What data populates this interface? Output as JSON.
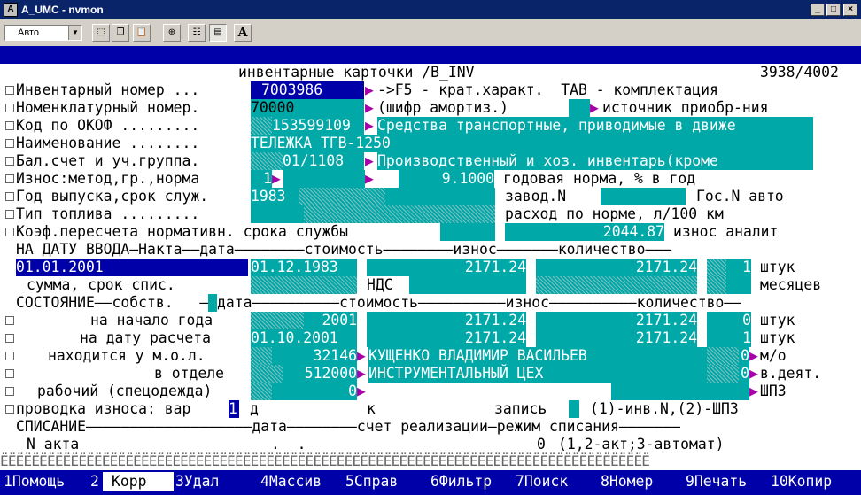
{
  "window": {
    "title": "A_UMC - nvmon",
    "controls": [
      "_",
      "□",
      "×"
    ]
  },
  "toolbar": {
    "font_select": "Авто",
    "a_button": "A"
  },
  "header": {
    "title": "инвентарные карточки /B_INV",
    "record": "3938/4002"
  },
  "form": {
    "inv_label": "Инвентарный номер ...",
    "inv_value": "7003986",
    "inv_hint": "->F5 - крат.характ.  TAB - комплектация",
    "nom_label": "Номенклатурный номер.",
    "nom_value": "70000",
    "shifr_label": "(шифр амортиз.)",
    "source_label": "источник приобр-ния",
    "okof_label": "Код по ОКОФ .........",
    "okof_code": "153599109",
    "okof_desc": "Средства транспортные, приводимые в движе",
    "name_label": "Наименование ........",
    "name_value": "ТЕЛЕЖКА ТГВ-1250",
    "bal_label": "Бал.счет и уч.группа.",
    "bal_value": "01/1108",
    "bal_desc": "Производственный и хоз. инвентарь(кроме",
    "iznos_label": "Износ:метод,гр.,норма",
    "iznos_method": "1",
    "iznos_rate": "9.1000",
    "iznos_rate_label": "годовая норма, % в год",
    "year_label": "Год выпуска,срок служ.",
    "year_value": "1983",
    "zavod_label": "завод.N",
    "gos_label": "Гос.N авто",
    "fuel_label": "Тип топлива .........",
    "fuel_consumption_label": "расход по норме, л/100 км",
    "koef_label": "Коэф.пересчета нормативн. срока службы",
    "iznos_analit_value": "2044.87",
    "iznos_analit_label": "износ аналит"
  },
  "vvod": {
    "header_line": "НА ДАТУ ВВОДА—Накта——дата————————стоимость————————износ———————количество———",
    "date": "01.01.2001",
    "akt_date": "01.12.1983",
    "cost": "2171.24",
    "wear": "2171.24",
    "qty": "1",
    "unit": "штук",
    "sum_label": "сумма, срок спис.",
    "nds_label": "НДС",
    "months_label": "месяцев"
  },
  "state": {
    "header_line": "СОСТОЯНИЕ——собств.   ——дата——————————стоимость——————————износ——————————количество——",
    "start_label": "на начало года",
    "start_date": "2001",
    "start_cost": "2171.24",
    "start_wear": "2171.24",
    "start_qty": "0",
    "start_unit": "штук",
    "calc_label": "на дату расчета",
    "calc_date": "01.10.2001",
    "calc_cost": "2171.24",
    "calc_wear": "2171.24",
    "calc_qty": "1",
    "calc_unit": "штук",
    "mol_label": "находится у м.о.л.",
    "mol_code": "32146",
    "mol_name": "КУЩЕНКО ВЛАДИМИР ВАСИЛЬЕВ",
    "mol_qty": "0",
    "mol_unit": "м/о",
    "dept_label": "в отделе",
    "dept_code": "512000",
    "dept_name": "ИНСТРУМЕНТАЛЬНЫЙ ЦЕХ",
    "dept_qty": "0",
    "dept_unit": "в.деят.",
    "work_label": "рабочий (спецодежда)",
    "work_code": "0",
    "work_unit": "ШПЗ"
  },
  "posting": {
    "label": "проводка износа: вар",
    "var": "1",
    "d_label": "д",
    "k_label": "к",
    "record_label": "запись",
    "record_hint": "(1)-инв.N,(2)-ШПЗ"
  },
  "writeoff": {
    "header_line": "СПИСАНИЕ———————————————————дата————————счет реализации—режим списания———————",
    "akt_label": "N акта",
    "akt_dots": ".  .",
    "mode_value": "0",
    "mode_hint": "(1,2-акт;3-автомат)"
  },
  "separator_text": "ЁЁЁЁЁЁЁЁЁЁЁЁЁЁЁЁЁЁЁЁЁЁЁЁЁЁЁЁЁЁЁЁЁЁЁЁЁЁЁЁЁЁЁЁЁЁЁЁЁЁЁЁЁЁЁЁЁЁЁЁЁЁЁЁЁЁЁЁЁЁЁЁЁЁЁЁЁЁЁЁЁЁЁ",
  "fkeys": [
    {
      "num": "1",
      "label": "Помощь"
    },
    {
      "num": "2",
      "label": "Корр"
    },
    {
      "num": "3",
      "label": "Удал"
    },
    {
      "num": "4",
      "label": "Массив"
    },
    {
      "num": "5",
      "label": "Справ"
    },
    {
      "num": "6",
      "label": "Фильтр"
    },
    {
      "num": "7",
      "label": "Поиск"
    },
    {
      "num": "8",
      "label": "Номер"
    },
    {
      "num": "9",
      "label": "Печать"
    },
    {
      "num": "10",
      "label": "Копир"
    }
  ],
  "colors": {
    "terminal_bg": "#0000a8",
    "field_cyan": "#00a8a8",
    "title_bar": "#0a246a",
    "accent_magenta": "#a800a8"
  }
}
